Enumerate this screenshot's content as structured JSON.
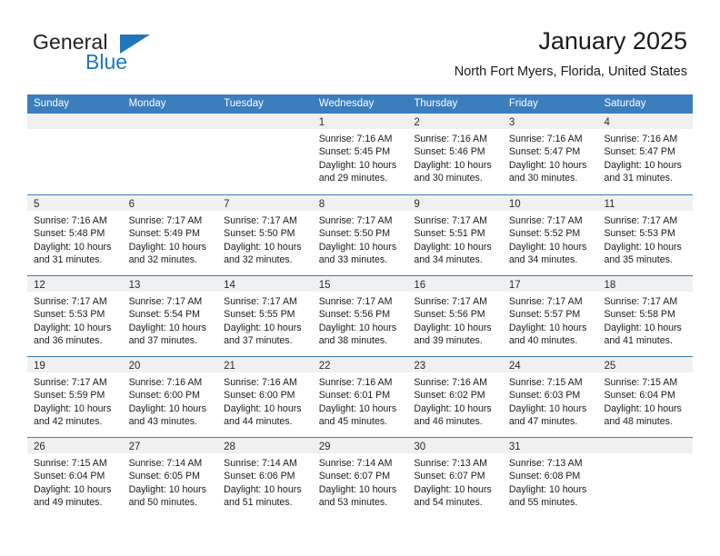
{
  "brand": {
    "name_part1": "General",
    "name_part2": "Blue"
  },
  "header": {
    "title": "January 2025",
    "subtitle": "North Fort Myers, Florida, United States"
  },
  "colors": {
    "header_blue": "#3b7dbd",
    "brand_blue": "#1f76bd",
    "day_band_gray": "#f0f0f0",
    "text": "#1a1a1a"
  },
  "weekdays": [
    "Sunday",
    "Monday",
    "Tuesday",
    "Wednesday",
    "Thursday",
    "Friday",
    "Saturday"
  ],
  "weeks": [
    [
      {
        "day": "",
        "lines": []
      },
      {
        "day": "",
        "lines": []
      },
      {
        "day": "",
        "lines": []
      },
      {
        "day": "1",
        "lines": [
          "Sunrise: 7:16 AM",
          "Sunset: 5:45 PM",
          "Daylight: 10 hours",
          "and 29 minutes."
        ]
      },
      {
        "day": "2",
        "lines": [
          "Sunrise: 7:16 AM",
          "Sunset: 5:46 PM",
          "Daylight: 10 hours",
          "and 30 minutes."
        ]
      },
      {
        "day": "3",
        "lines": [
          "Sunrise: 7:16 AM",
          "Sunset: 5:47 PM",
          "Daylight: 10 hours",
          "and 30 minutes."
        ]
      },
      {
        "day": "4",
        "lines": [
          "Sunrise: 7:16 AM",
          "Sunset: 5:47 PM",
          "Daylight: 10 hours",
          "and 31 minutes."
        ]
      }
    ],
    [
      {
        "day": "5",
        "lines": [
          "Sunrise: 7:16 AM",
          "Sunset: 5:48 PM",
          "Daylight: 10 hours",
          "and 31 minutes."
        ]
      },
      {
        "day": "6",
        "lines": [
          "Sunrise: 7:17 AM",
          "Sunset: 5:49 PM",
          "Daylight: 10 hours",
          "and 32 minutes."
        ]
      },
      {
        "day": "7",
        "lines": [
          "Sunrise: 7:17 AM",
          "Sunset: 5:50 PM",
          "Daylight: 10 hours",
          "and 32 minutes."
        ]
      },
      {
        "day": "8",
        "lines": [
          "Sunrise: 7:17 AM",
          "Sunset: 5:50 PM",
          "Daylight: 10 hours",
          "and 33 minutes."
        ]
      },
      {
        "day": "9",
        "lines": [
          "Sunrise: 7:17 AM",
          "Sunset: 5:51 PM",
          "Daylight: 10 hours",
          "and 34 minutes."
        ]
      },
      {
        "day": "10",
        "lines": [
          "Sunrise: 7:17 AM",
          "Sunset: 5:52 PM",
          "Daylight: 10 hours",
          "and 34 minutes."
        ]
      },
      {
        "day": "11",
        "lines": [
          "Sunrise: 7:17 AM",
          "Sunset: 5:53 PM",
          "Daylight: 10 hours",
          "and 35 minutes."
        ]
      }
    ],
    [
      {
        "day": "12",
        "lines": [
          "Sunrise: 7:17 AM",
          "Sunset: 5:53 PM",
          "Daylight: 10 hours",
          "and 36 minutes."
        ]
      },
      {
        "day": "13",
        "lines": [
          "Sunrise: 7:17 AM",
          "Sunset: 5:54 PM",
          "Daylight: 10 hours",
          "and 37 minutes."
        ]
      },
      {
        "day": "14",
        "lines": [
          "Sunrise: 7:17 AM",
          "Sunset: 5:55 PM",
          "Daylight: 10 hours",
          "and 37 minutes."
        ]
      },
      {
        "day": "15",
        "lines": [
          "Sunrise: 7:17 AM",
          "Sunset: 5:56 PM",
          "Daylight: 10 hours",
          "and 38 minutes."
        ]
      },
      {
        "day": "16",
        "lines": [
          "Sunrise: 7:17 AM",
          "Sunset: 5:56 PM",
          "Daylight: 10 hours",
          "and 39 minutes."
        ]
      },
      {
        "day": "17",
        "lines": [
          "Sunrise: 7:17 AM",
          "Sunset: 5:57 PM",
          "Daylight: 10 hours",
          "and 40 minutes."
        ]
      },
      {
        "day": "18",
        "lines": [
          "Sunrise: 7:17 AM",
          "Sunset: 5:58 PM",
          "Daylight: 10 hours",
          "and 41 minutes."
        ]
      }
    ],
    [
      {
        "day": "19",
        "lines": [
          "Sunrise: 7:17 AM",
          "Sunset: 5:59 PM",
          "Daylight: 10 hours",
          "and 42 minutes."
        ]
      },
      {
        "day": "20",
        "lines": [
          "Sunrise: 7:16 AM",
          "Sunset: 6:00 PM",
          "Daylight: 10 hours",
          "and 43 minutes."
        ]
      },
      {
        "day": "21",
        "lines": [
          "Sunrise: 7:16 AM",
          "Sunset: 6:00 PM",
          "Daylight: 10 hours",
          "and 44 minutes."
        ]
      },
      {
        "day": "22",
        "lines": [
          "Sunrise: 7:16 AM",
          "Sunset: 6:01 PM",
          "Daylight: 10 hours",
          "and 45 minutes."
        ]
      },
      {
        "day": "23",
        "lines": [
          "Sunrise: 7:16 AM",
          "Sunset: 6:02 PM",
          "Daylight: 10 hours",
          "and 46 minutes."
        ]
      },
      {
        "day": "24",
        "lines": [
          "Sunrise: 7:15 AM",
          "Sunset: 6:03 PM",
          "Daylight: 10 hours",
          "and 47 minutes."
        ]
      },
      {
        "day": "25",
        "lines": [
          "Sunrise: 7:15 AM",
          "Sunset: 6:04 PM",
          "Daylight: 10 hours",
          "and 48 minutes."
        ]
      }
    ],
    [
      {
        "day": "26",
        "lines": [
          "Sunrise: 7:15 AM",
          "Sunset: 6:04 PM",
          "Daylight: 10 hours",
          "and 49 minutes."
        ]
      },
      {
        "day": "27",
        "lines": [
          "Sunrise: 7:14 AM",
          "Sunset: 6:05 PM",
          "Daylight: 10 hours",
          "and 50 minutes."
        ]
      },
      {
        "day": "28",
        "lines": [
          "Sunrise: 7:14 AM",
          "Sunset: 6:06 PM",
          "Daylight: 10 hours",
          "and 51 minutes."
        ]
      },
      {
        "day": "29",
        "lines": [
          "Sunrise: 7:14 AM",
          "Sunset: 6:07 PM",
          "Daylight: 10 hours",
          "and 53 minutes."
        ]
      },
      {
        "day": "30",
        "lines": [
          "Sunrise: 7:13 AM",
          "Sunset: 6:07 PM",
          "Daylight: 10 hours",
          "and 54 minutes."
        ]
      },
      {
        "day": "31",
        "lines": [
          "Sunrise: 7:13 AM",
          "Sunset: 6:08 PM",
          "Daylight: 10 hours",
          "and 55 minutes."
        ]
      },
      {
        "day": "",
        "lines": []
      }
    ]
  ]
}
